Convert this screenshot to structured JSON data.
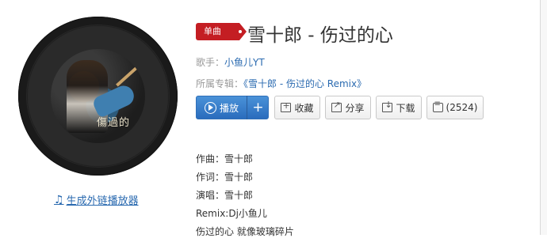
{
  "song": {
    "tag": "单曲",
    "title": "雪十郎 - 伤过的心",
    "artist_label": "歌手：",
    "artist": "小鱼儿YT",
    "album_label": "所属专辑：",
    "album": "《雪十郎 - 伤过的心 Remix》",
    "cover_text": "傷過的"
  },
  "actions": {
    "play": "播放",
    "add": "+",
    "collect": "收藏",
    "share": "分享",
    "download": "下载",
    "comment": "(2524)"
  },
  "external_player": "生成外链播放器",
  "lyrics": [
    "作曲：雪十郎",
    "作词：雪十郎",
    "演唱：雪十郎",
    "Remix:Dj小鱼儿",
    "伤过的心 就像玻璃碎片"
  ],
  "colors": {
    "tag_red": "#c41e23",
    "play_blue": "#2a6cbd",
    "link_blue": "#2a6ab0"
  }
}
